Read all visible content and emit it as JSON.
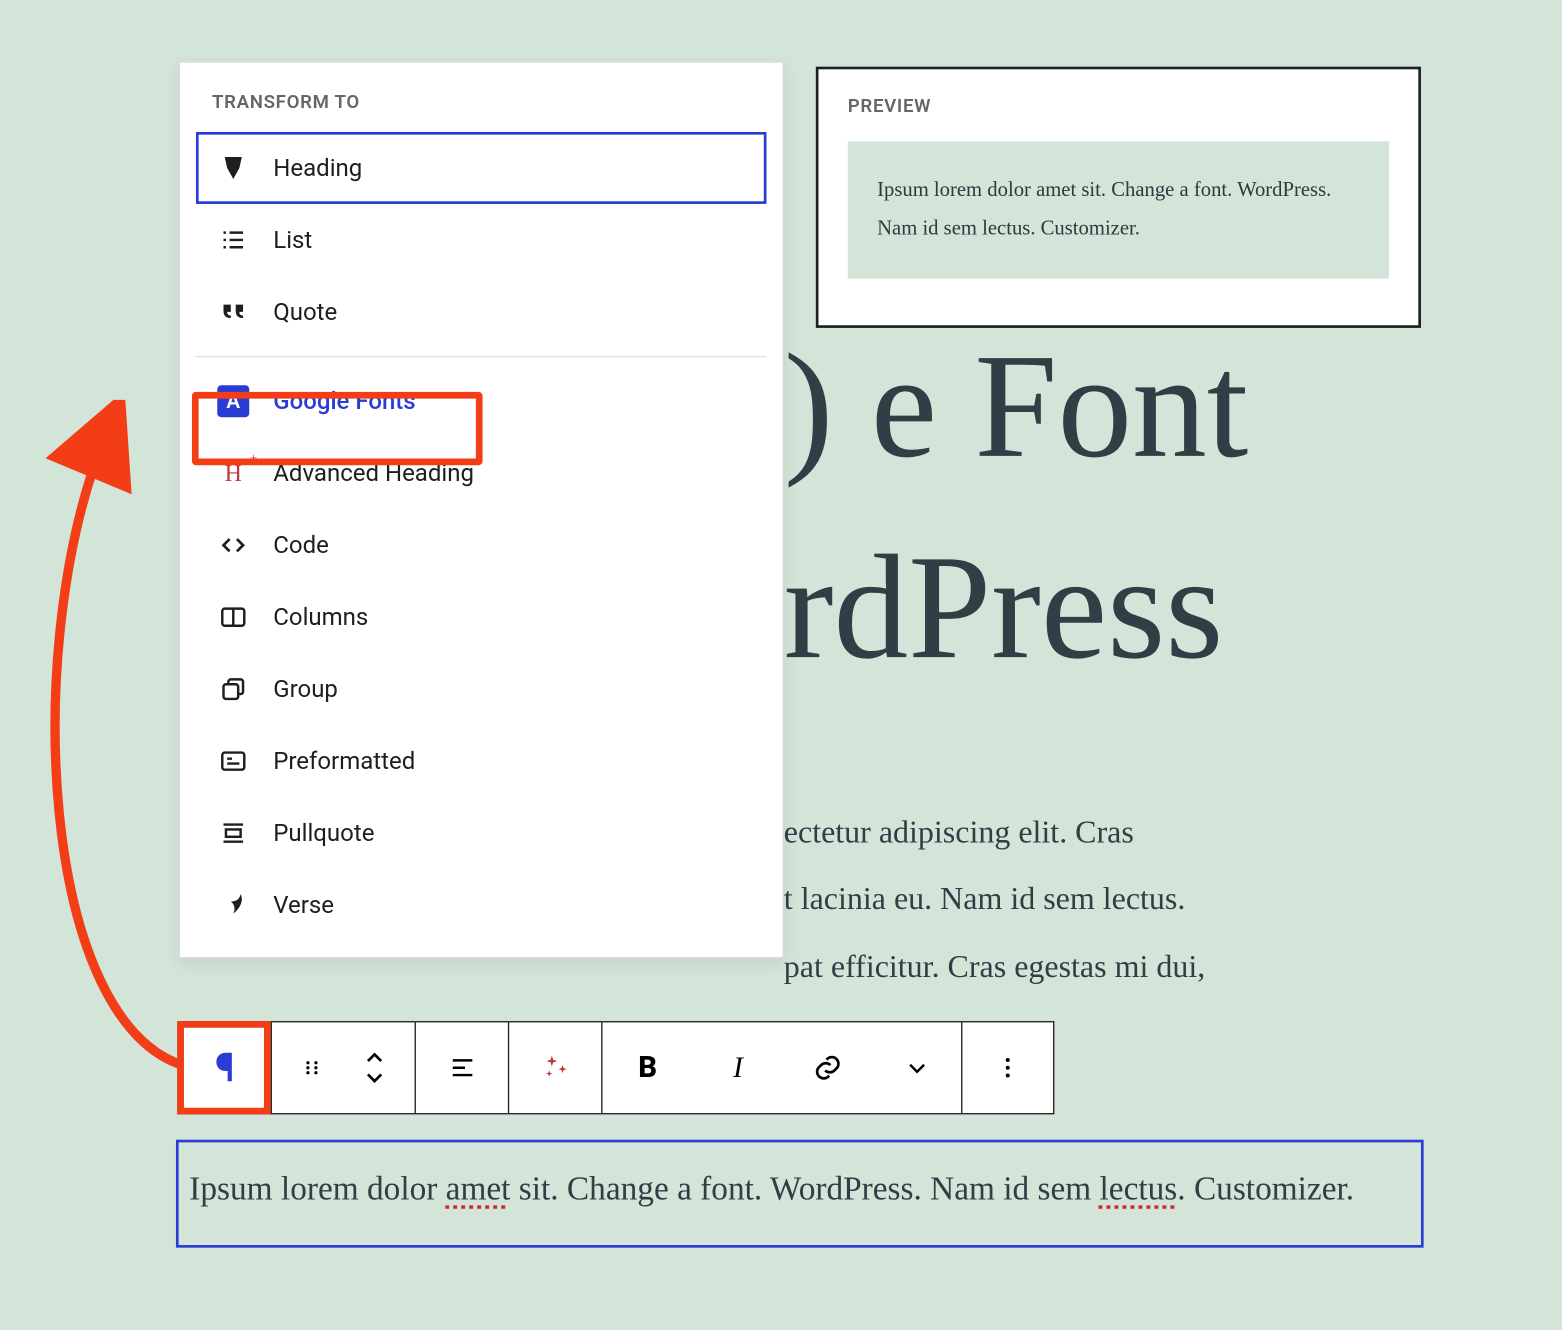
{
  "popover": {
    "title": "TRANSFORM TO",
    "groups": {
      "core": [
        {
          "id": "heading",
          "label": "Heading",
          "selected": true
        },
        {
          "id": "list",
          "label": "List"
        },
        {
          "id": "quote",
          "label": "Quote"
        }
      ],
      "extras": [
        {
          "id": "google-fonts",
          "label": "Google Fonts",
          "highlighted": true
        },
        {
          "id": "advanced-heading",
          "label": "Advanced Heading"
        },
        {
          "id": "code",
          "label": "Code"
        },
        {
          "id": "columns",
          "label": "Columns"
        },
        {
          "id": "group",
          "label": "Group"
        },
        {
          "id": "preformatted",
          "label": "Preformatted"
        },
        {
          "id": "pullquote",
          "label": "Pullquote"
        },
        {
          "id": "verse",
          "label": "Verse"
        }
      ]
    }
  },
  "preview": {
    "title": "PREVIEW",
    "text": "Ipsum lorem dolor amet sit. Change a font. WordPress. Nam id sem lectus. Customizer."
  },
  "background": {
    "heading_line1": "e Font",
    "heading_line2": "rdPress",
    "heading_prefix": ")",
    "paragraph": "ectetur adipiscing elit. Cras\nt lacinia eu. Nam id sem lectus.\npat efficitur. Cras egestas mi dui,"
  },
  "toolbar": {
    "items": [
      {
        "id": "block-type",
        "name": "Paragraph"
      },
      {
        "id": "drag",
        "name": "Drag"
      },
      {
        "id": "move",
        "name": "Move up/down"
      },
      {
        "id": "align",
        "name": "Align"
      },
      {
        "id": "ai",
        "name": "AI tools"
      },
      {
        "id": "bold",
        "name": "Bold"
      },
      {
        "id": "italic",
        "name": "Italic"
      },
      {
        "id": "link",
        "name": "Link"
      },
      {
        "id": "more-inline",
        "name": "More rich text"
      },
      {
        "id": "options",
        "name": "Options"
      }
    ]
  },
  "selected_block": {
    "text_parts": {
      "p1": "Ipsum lorem dolor ",
      "w1": "amet",
      "p2": " sit. Change a font. WordPress. Nam id sem ",
      "w2": "lectus",
      "p3": ". Customizer."
    }
  },
  "annotation": {
    "arrow_color": "#f23d16"
  }
}
